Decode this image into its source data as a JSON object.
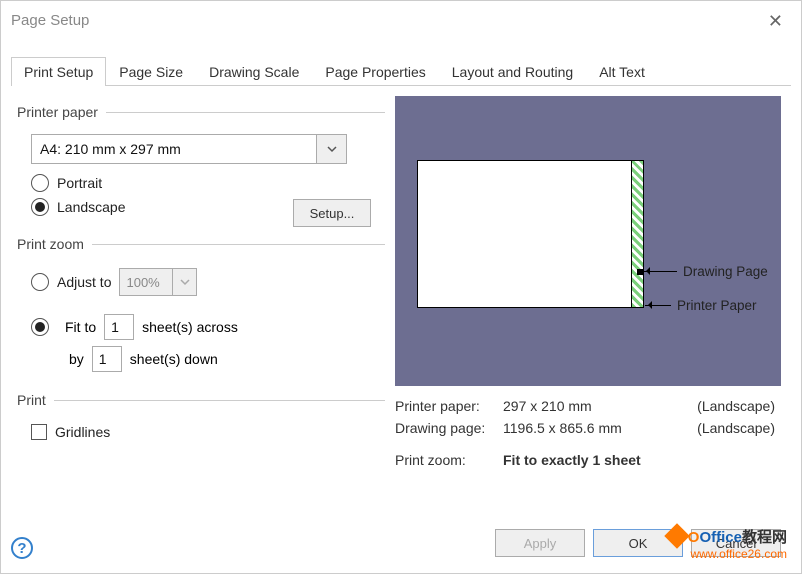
{
  "window": {
    "title": "Page Setup"
  },
  "tabs": {
    "items": [
      "Print Setup",
      "Page Size",
      "Drawing Scale",
      "Page Properties",
      "Layout and Routing",
      "Alt Text"
    ],
    "active": 0
  },
  "printer_paper": {
    "legend": "Printer paper",
    "paper_size": "A4:  210 mm x 297 mm",
    "portrait_label": "Portrait",
    "landscape_label": "Landscape",
    "orientation": "landscape",
    "setup_button": "Setup..."
  },
  "print_zoom": {
    "legend": "Print zoom",
    "adjust_label": "Adjust to",
    "adjust_value": "100%",
    "fit_label": "Fit to",
    "sheets_across_value": "1",
    "sheets_across_label": "sheet(s) across",
    "by_label": "by",
    "sheets_down_value": "1",
    "sheets_down_label": "sheet(s) down",
    "mode": "fit"
  },
  "print": {
    "legend": "Print",
    "gridlines_label": "Gridlines",
    "gridlines_checked": false
  },
  "preview": {
    "drawing_page_label": "Drawing Page",
    "printer_paper_label": "Printer Paper"
  },
  "info": {
    "printer_paper_key": "Printer paper:",
    "printer_paper_val": "297 x 210 mm",
    "printer_paper_orient": "(Landscape)",
    "drawing_page_key": "Drawing page:",
    "drawing_page_val": "1196.5 x 865.6 mm",
    "drawing_page_orient": "(Landscape)",
    "print_zoom_key": "Print zoom:",
    "print_zoom_val": "Fit to exactly 1 sheet"
  },
  "buttons": {
    "apply": "Apply",
    "ok": "OK",
    "cancel": "Cancel"
  },
  "watermark": {
    "line1a": "Office",
    "line1b": "教程网",
    "line2": "www.office26.com"
  }
}
